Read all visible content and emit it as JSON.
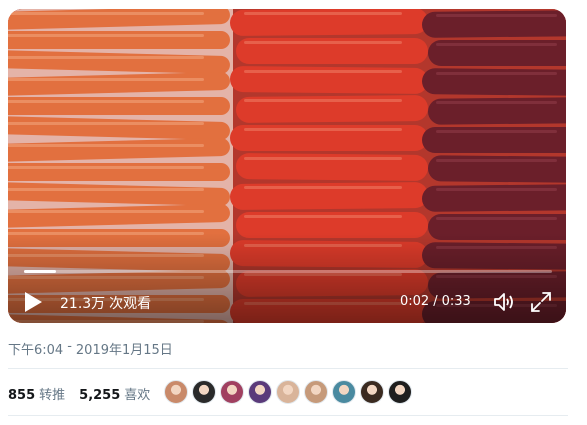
{
  "video": {
    "view_count": "21.3万",
    "view_suffix": "次观看",
    "current_time": "0:02",
    "time_separator": "/",
    "duration": "0:33",
    "progress_fraction": 0.06
  },
  "timestamp": {
    "time": "下午6:04",
    "separator": "-",
    "date": "2019年1月15日"
  },
  "stats": {
    "retweets_count": "855",
    "retweets_label": "转推",
    "likes_count": "5,255",
    "likes_label": "喜欢"
  },
  "likers": [
    {
      "color": "#c98a6a"
    },
    {
      "color": "#2a2a2a"
    },
    {
      "color": "#a04060"
    },
    {
      "color": "#5a3a7a"
    },
    {
      "color": "#d9b49a"
    },
    {
      "color": "#c69a7a"
    },
    {
      "color": "#4a8aa0"
    },
    {
      "color": "#3a2a20"
    },
    {
      "color": "#1e1e1e"
    }
  ],
  "icons": {
    "play": "play-icon",
    "volume": "volume-icon",
    "fullscreen": "fullscreen-icon"
  }
}
